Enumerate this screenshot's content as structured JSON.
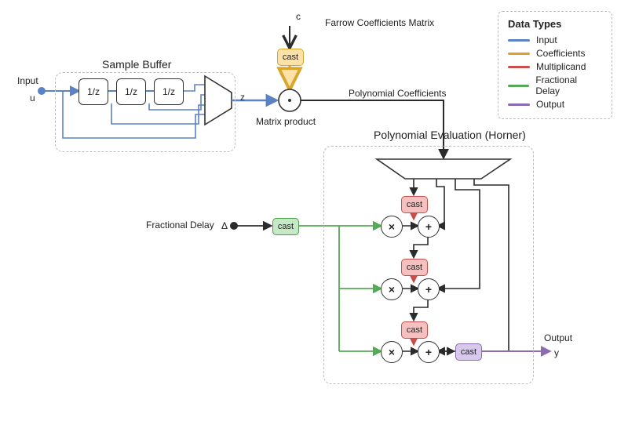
{
  "labels": {
    "input": "Input",
    "input_sym": "u",
    "sample_buffer": "Sample Buffer",
    "delay": "1/z",
    "z_out": "z",
    "matrix_product": "Matrix product",
    "farrow_c": "c",
    "farrow_title": "Farrow Coefficients Matrix",
    "poly_coef": "Polynomial Coefficients",
    "horner_title": "Polynomial Evaluation (Horner)",
    "frac_delay": "Fractional Delay",
    "frac_delay_sym": "Δ",
    "output": "Output",
    "output_sym": "y",
    "cast": "cast",
    "mult": "×",
    "add": "+",
    "mp_dot": "·"
  },
  "legend": {
    "title": "Data Types",
    "items": [
      {
        "label": "Input",
        "color": "#5a82c5"
      },
      {
        "label": "Coefficients",
        "color": "#e0a22b"
      },
      {
        "label": "Multiplicand",
        "color": "#c94d4d"
      },
      {
        "label": "Fractional Delay",
        "color": "#55a855"
      },
      {
        "label": "Output",
        "color": "#8c6bb1"
      }
    ]
  },
  "colors": {
    "input": "#5a82c5",
    "coef": "#e0a22b",
    "mult": "#c94d4d",
    "frac": "#55a855",
    "out": "#8c6bb1",
    "sig": "#2b2b2b"
  }
}
